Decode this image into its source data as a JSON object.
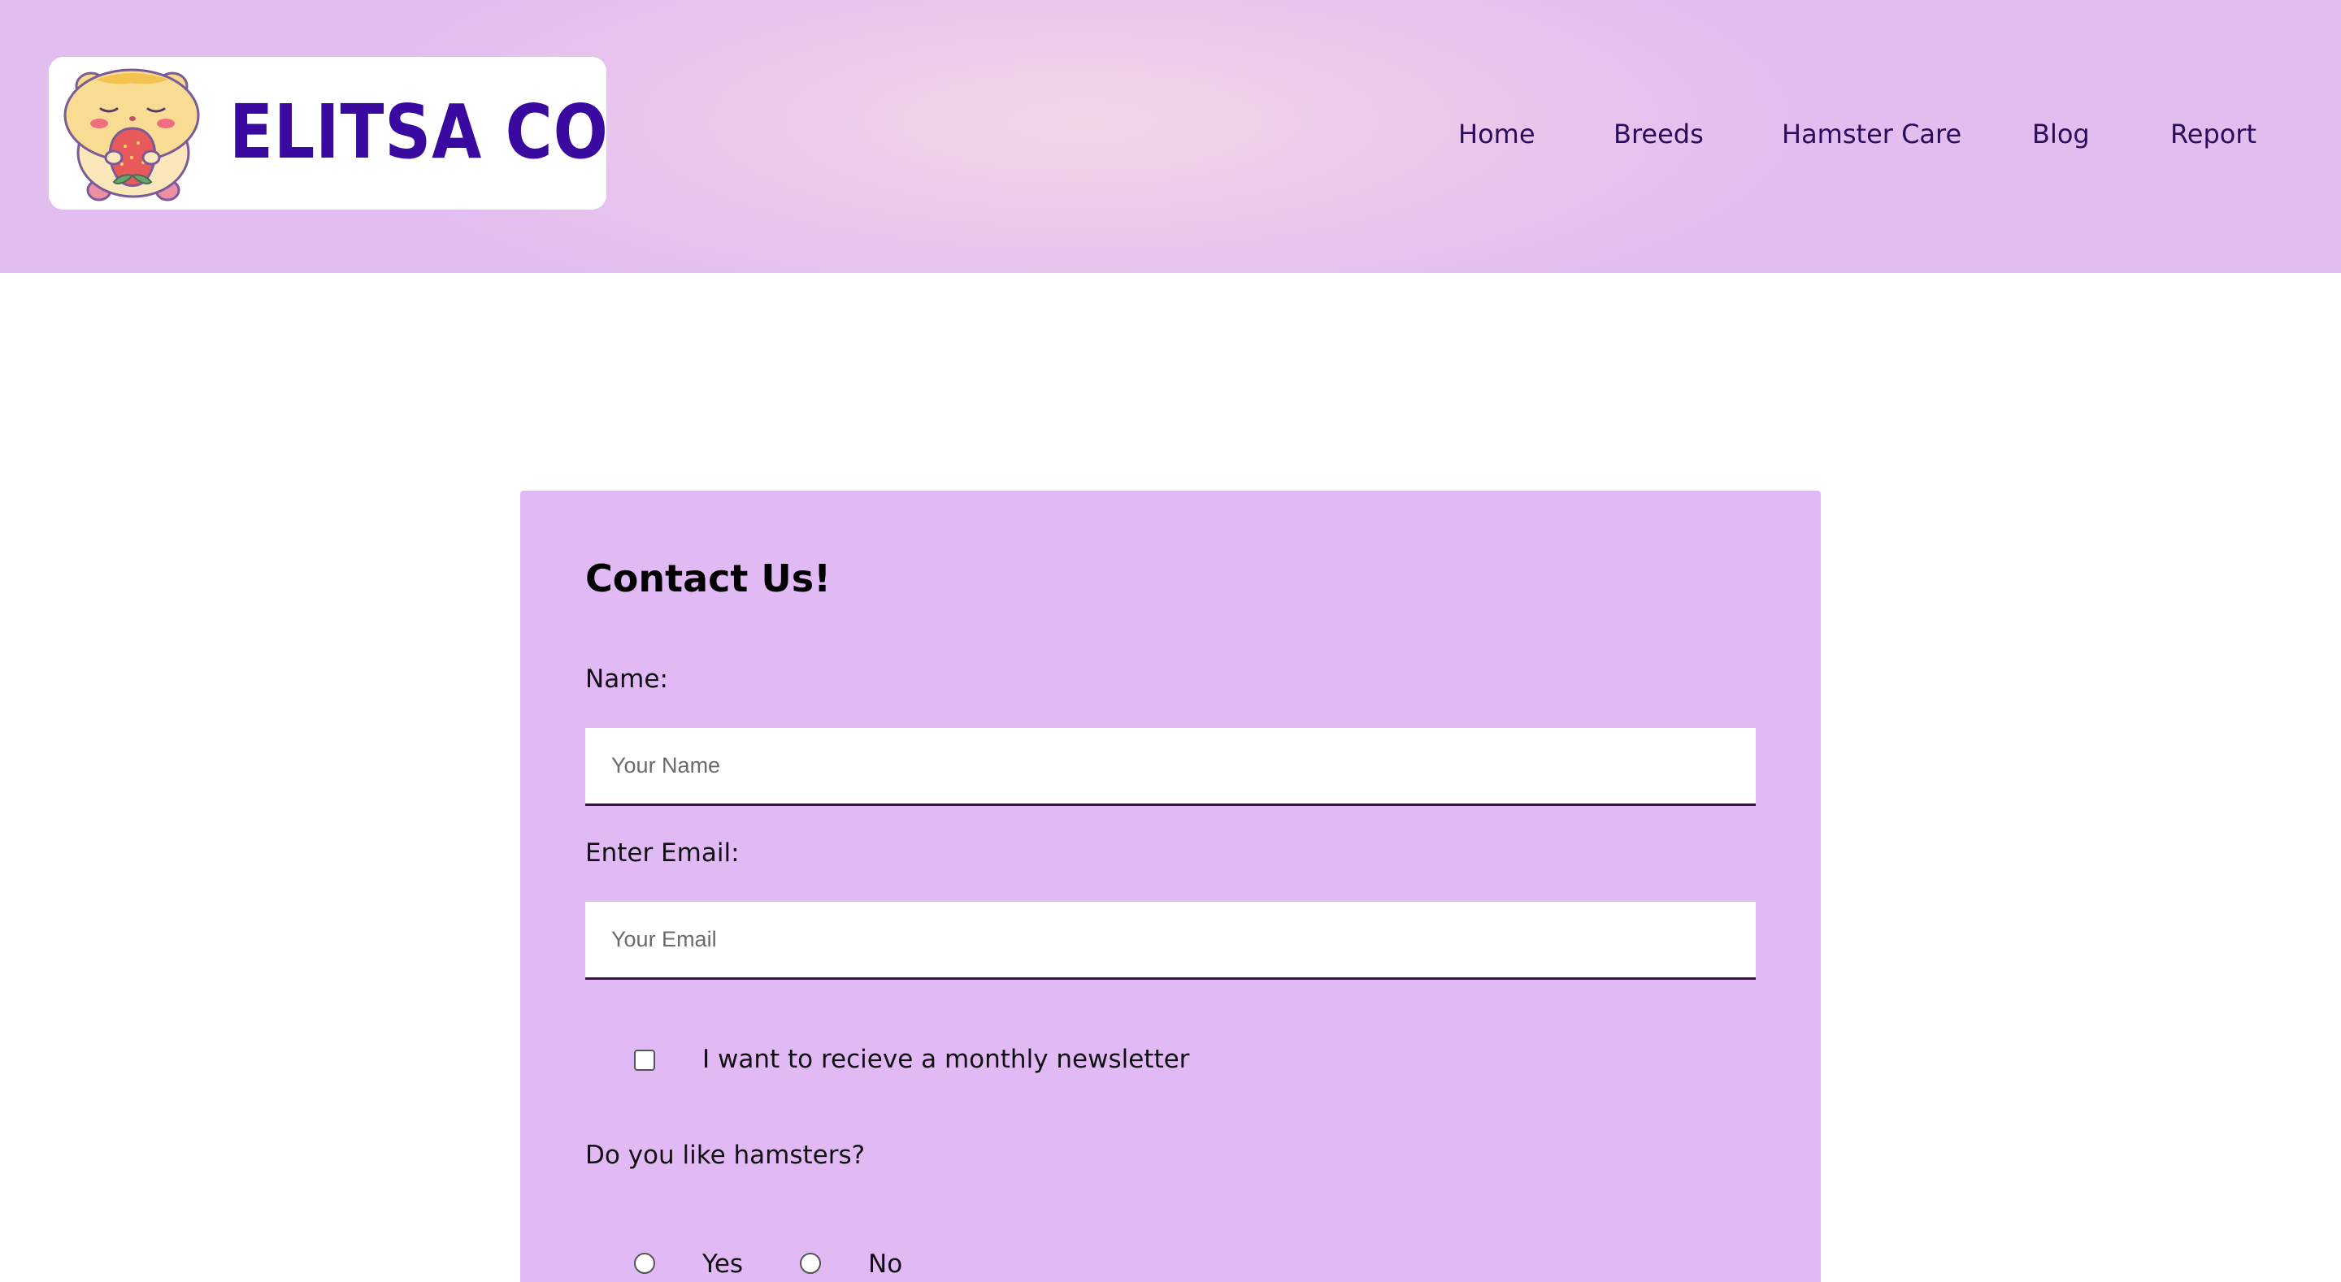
{
  "brand": {
    "name": "ELITSA CO",
    "logo_icon": "hamster-with-strawberry-icon",
    "color": "#3a0aa0"
  },
  "nav": {
    "items": [
      {
        "label": "Home"
      },
      {
        "label": "Breeds"
      },
      {
        "label": "Hamster Care"
      },
      {
        "label": "Blog"
      },
      {
        "label": "Report"
      }
    ]
  },
  "form": {
    "title": "Contact Us!",
    "name_label": "Name:",
    "name_placeholder": "Your Name",
    "name_value": "",
    "email_label": "Enter Email:",
    "email_placeholder": "Your Email",
    "email_value": "",
    "newsletter_label": "I want to recieve a monthly newsletter",
    "newsletter_checked": false,
    "question": "Do you like hamsters?",
    "options": [
      {
        "label": "Yes",
        "selected": false
      },
      {
        "label": "No",
        "selected": false
      }
    ]
  },
  "colors": {
    "header_bg": "#e2bdf0",
    "card_bg": "#e0b9f5",
    "nav_text": "#2a0a5a"
  }
}
